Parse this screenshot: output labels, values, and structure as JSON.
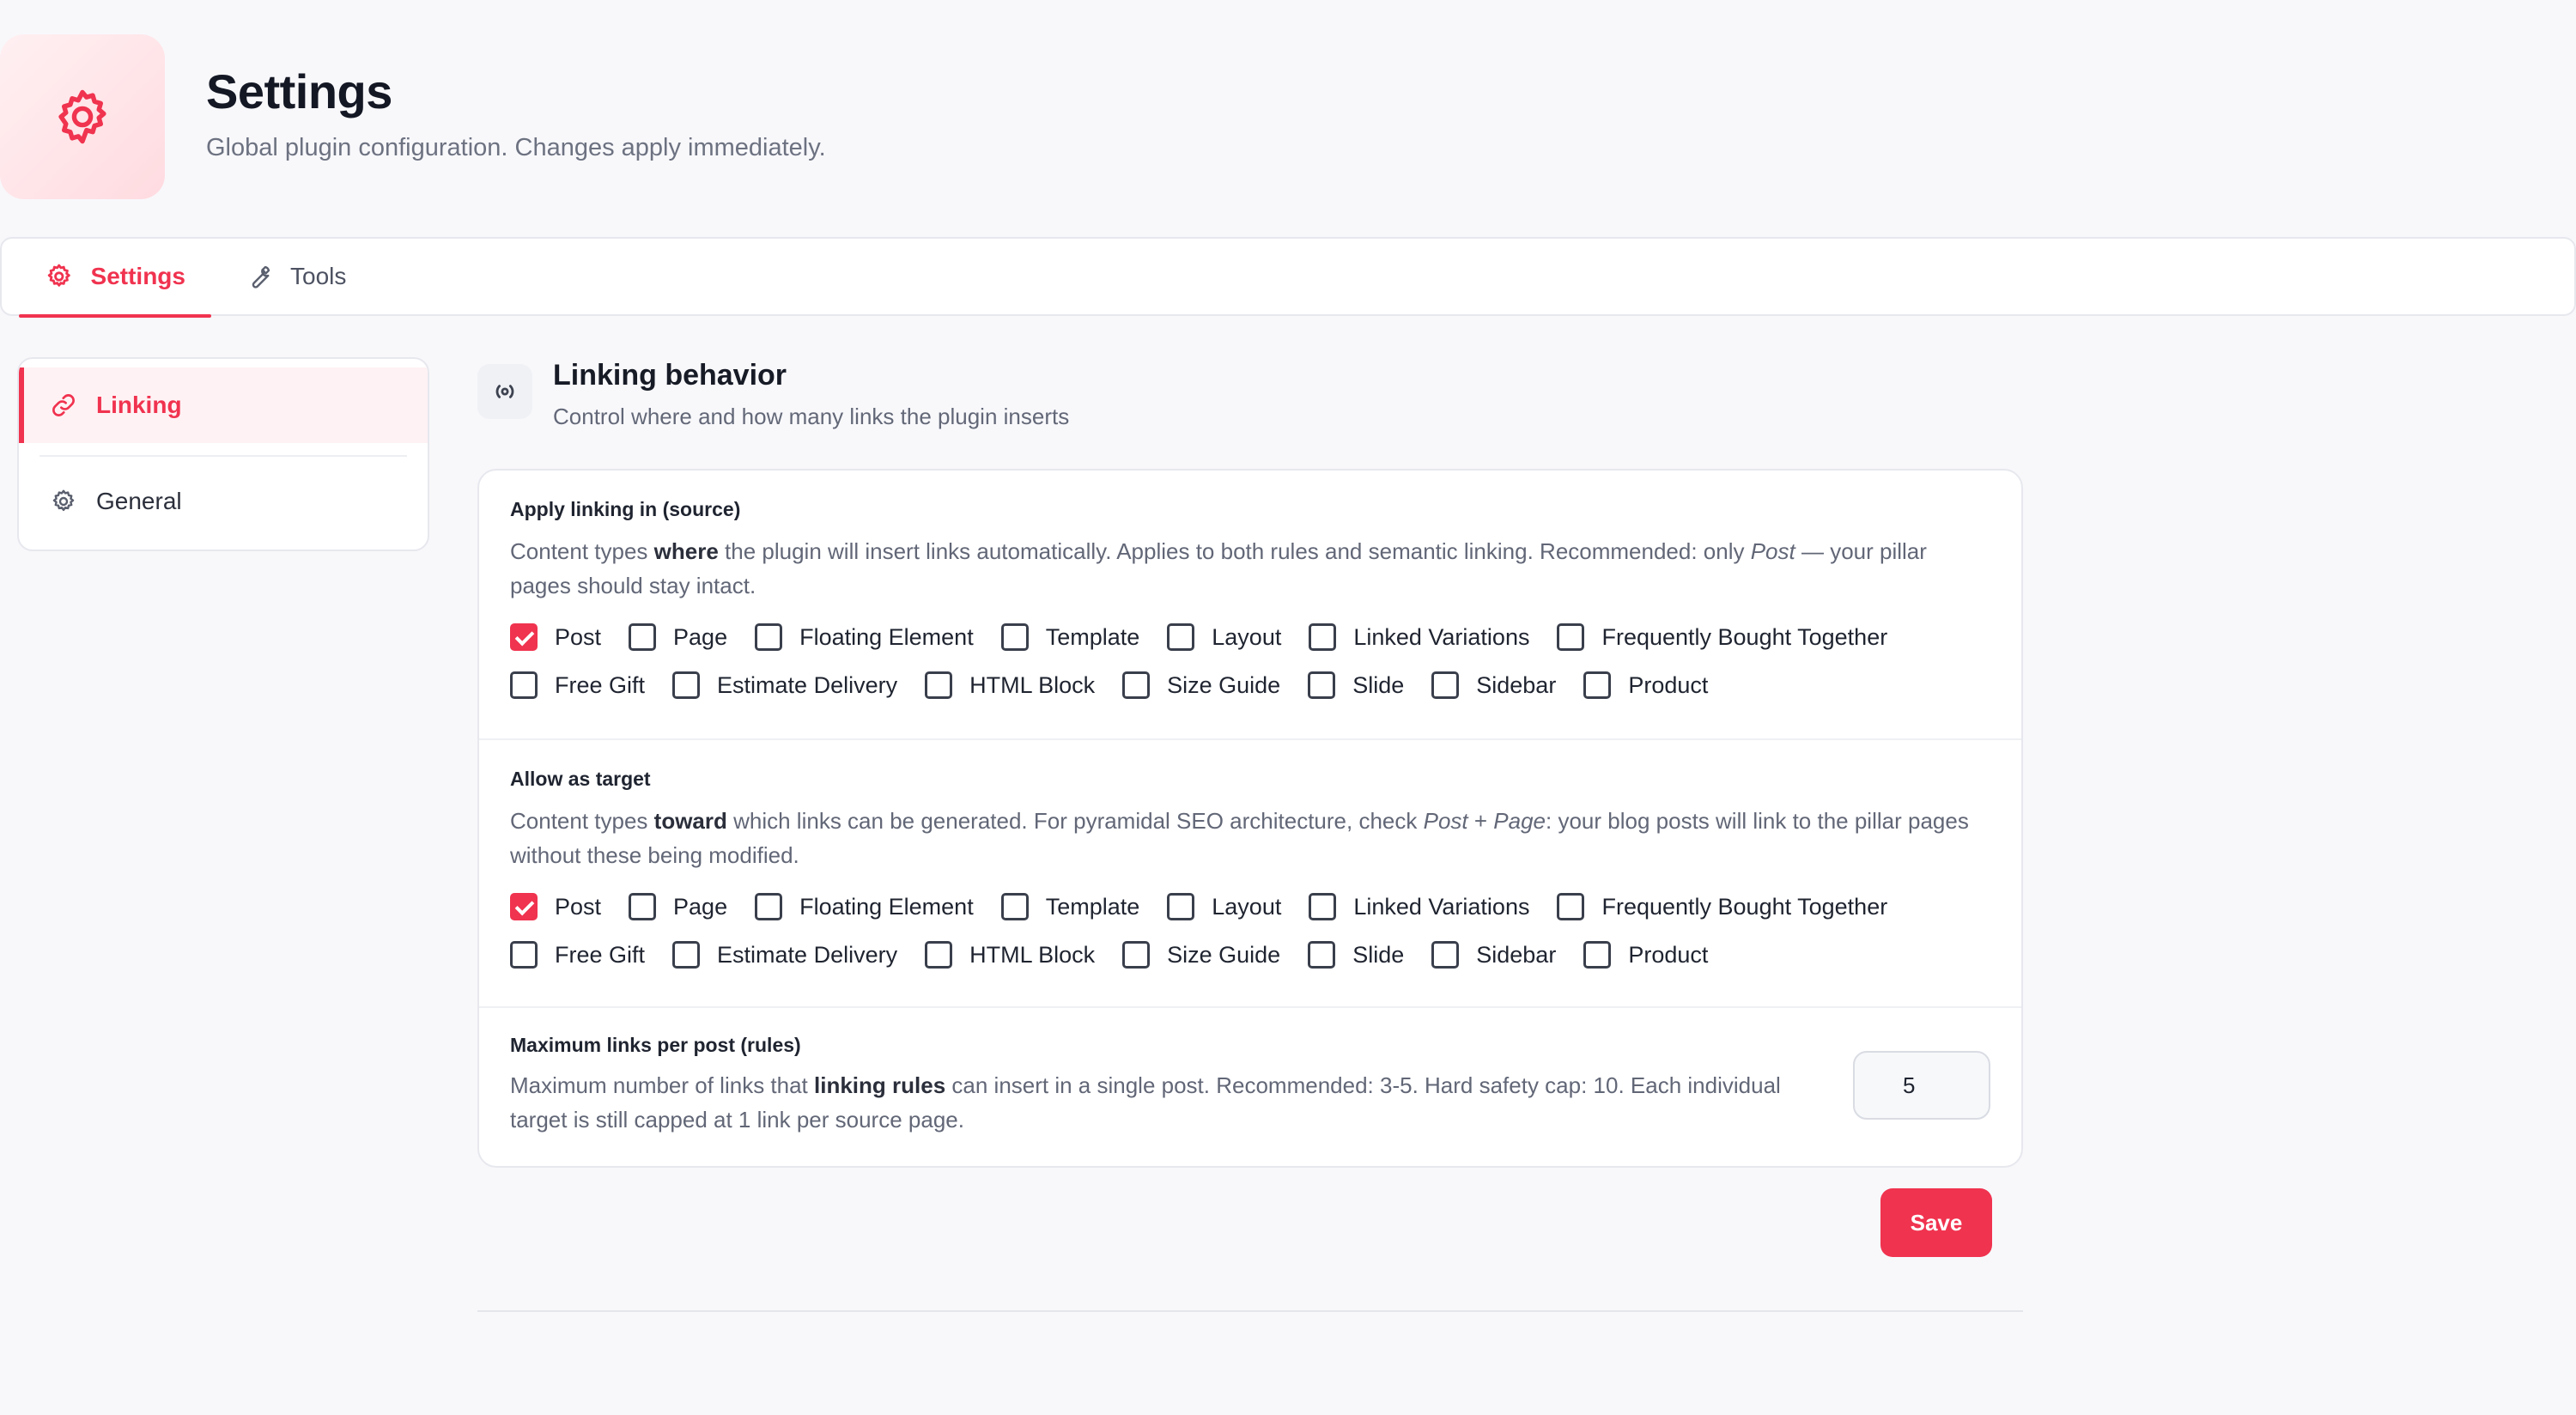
{
  "header": {
    "title": "Settings",
    "subtitle": "Global plugin configuration. Changes apply immediately."
  },
  "tabs": [
    {
      "label": "Settings",
      "icon": "gear-icon",
      "active": true
    },
    {
      "label": "Tools",
      "icon": "wrench-icon",
      "active": false
    }
  ],
  "sidebar": {
    "items": [
      {
        "label": "Linking",
        "icon": "link-icon",
        "active": true
      },
      {
        "label": "General",
        "icon": "gear-icon",
        "active": false
      }
    ]
  },
  "section": {
    "icon": "radio-icon",
    "title": "Linking behavior",
    "subtitle": "Control where and how many links the plugin inserts"
  },
  "source": {
    "label": "Apply linking in (source)",
    "desc_pre": "Content types ",
    "desc_bold": "where",
    "desc_mid": " the plugin will insert links automatically. Applies to both rules and semantic linking. Recommended: only ",
    "desc_italic": "Post",
    "desc_post": " — your pillar pages should stay intact.",
    "options": [
      {
        "label": "Post",
        "checked": true
      },
      {
        "label": "Page",
        "checked": false
      },
      {
        "label": "Floating Element",
        "checked": false
      },
      {
        "label": "Template",
        "checked": false
      },
      {
        "label": "Layout",
        "checked": false
      },
      {
        "label": "Linked Variations",
        "checked": false
      },
      {
        "label": "Frequently Bought Together",
        "checked": false
      },
      {
        "label": "Free Gift",
        "checked": false
      },
      {
        "label": "Estimate Delivery",
        "checked": false
      },
      {
        "label": "HTML Block",
        "checked": false
      },
      {
        "label": "Size Guide",
        "checked": false
      },
      {
        "label": "Slide",
        "checked": false
      },
      {
        "label": "Sidebar",
        "checked": false
      },
      {
        "label": "Product",
        "checked": false
      }
    ]
  },
  "target": {
    "label": "Allow as target",
    "desc_pre": "Content types ",
    "desc_bold": "toward",
    "desc_mid": " which links can be generated. For pyramidal SEO architecture, check ",
    "desc_italic": "Post",
    "desc_plus": " + ",
    "desc_italic2": "Page",
    "desc_post": ": your blog posts will link to the pillar pages without these being modified.",
    "options": [
      {
        "label": "Post",
        "checked": true
      },
      {
        "label": "Page",
        "checked": false
      },
      {
        "label": "Floating Element",
        "checked": false
      },
      {
        "label": "Template",
        "checked": false
      },
      {
        "label": "Layout",
        "checked": false
      },
      {
        "label": "Linked Variations",
        "checked": false
      },
      {
        "label": "Frequently Bought Together",
        "checked": false
      },
      {
        "label": "Free Gift",
        "checked": false
      },
      {
        "label": "Estimate Delivery",
        "checked": false
      },
      {
        "label": "HTML Block",
        "checked": false
      },
      {
        "label": "Size Guide",
        "checked": false
      },
      {
        "label": "Slide",
        "checked": false
      },
      {
        "label": "Sidebar",
        "checked": false
      },
      {
        "label": "Product",
        "checked": false
      }
    ]
  },
  "max_links": {
    "label": "Maximum links per post (rules)",
    "desc_pre": "Maximum number of links that ",
    "desc_bold": "linking rules",
    "desc_post": " can insert in a single post. Recommended: 3-5. Hard safety cap: 10. Each individual target is still capped at 1 link per source page.",
    "value": "5"
  },
  "save_label": "Save",
  "colors": {
    "accent": "#f0334f",
    "background": "#f8f8fb"
  }
}
